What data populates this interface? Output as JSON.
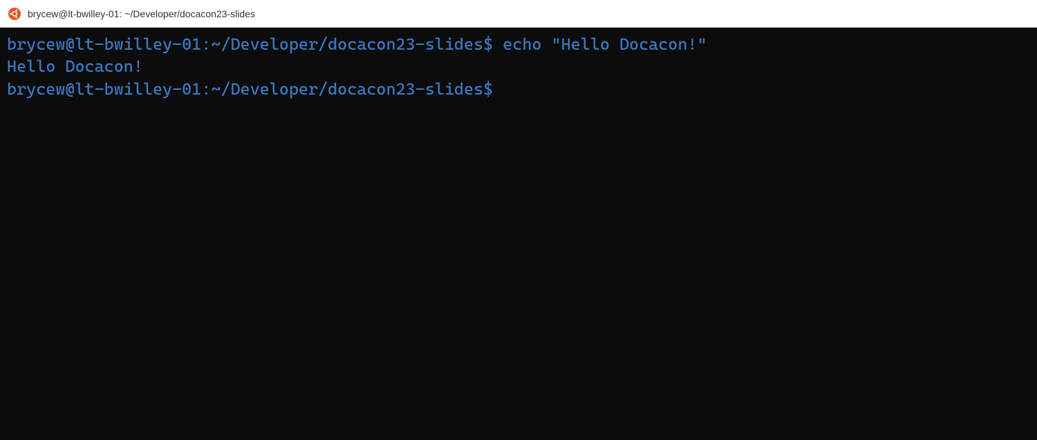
{
  "window": {
    "title": "brycew@lt-bwilley-01: ~/Developer/docacon23-slides"
  },
  "terminal": {
    "lines": [
      {
        "prompt": "brycew@lt-bwilley-01:~/Developer/docacon23-slides$",
        "command": " echo \"Hello Docacon!\""
      },
      {
        "output": "Hello Docacon!"
      },
      {
        "prompt": "brycew@lt-bwilley-01:~/Developer/docacon23-slides$",
        "command": ""
      }
    ]
  },
  "colors": {
    "terminal_bg": "#0c0c0c",
    "prompt_fg": "#3b78c2",
    "titlebar_bg": "#ffffff"
  }
}
